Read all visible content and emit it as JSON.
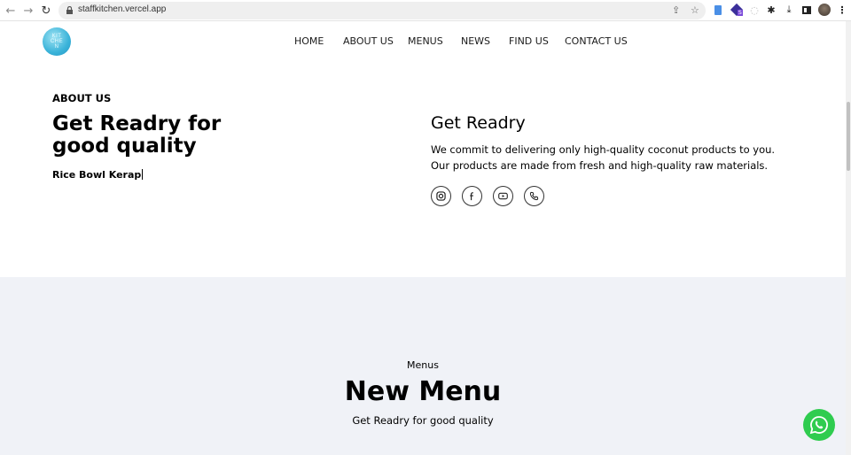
{
  "browser": {
    "url": "staffkitchen.vercel.app",
    "back_icon": "arrow-left",
    "forward_icon": "arrow-right",
    "reload_icon": "reload",
    "extensions": [
      "share-icon",
      "star-icon",
      "clipboard-extension",
      "stack-extension",
      "circle-extension",
      "puzzle-icon",
      "download-icon",
      "sidepanel-icon",
      "profile-avatar",
      "kebab-menu-icon"
    ],
    "extension_badge": "S"
  },
  "site": {
    "logo_text": [
      "KIT",
      "CHE",
      "N"
    ],
    "nav": [
      "HOME",
      "ABOUT US",
      "MENUS",
      "NEWS",
      "FIND US",
      "CONTACT US"
    ]
  },
  "about": {
    "label": "ABOUT US",
    "title": "Get Readry for good quality",
    "typed_text": "Rice Bowl Kerap",
    "right_title": "Get Readry",
    "description": "We commit to delivering only high-quality coconut products to you. Our products are made from fresh and high-quality raw materials.",
    "socials": [
      "instagram",
      "facebook",
      "youtube",
      "phone"
    ]
  },
  "menus": {
    "label": "Menus",
    "title": "New Menu",
    "subtitle": "Get Readry for good quality"
  },
  "colors": {
    "section_bg": "#f0f2f7",
    "whatsapp": "#2fcc4f",
    "logo": "#3ab3d9"
  }
}
